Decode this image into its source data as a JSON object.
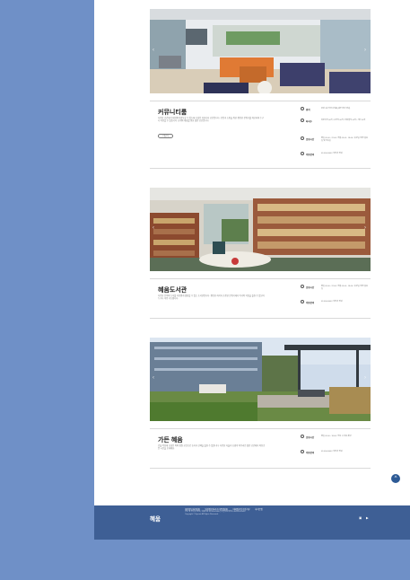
{
  "sections": [
    {
      "title": "커뮤니티룸",
      "desc": "다양한 공간에서 자유롭게 활동할 수 있도록 조성된 커뮤니티 공간입니다. 모임과 소통을 위한 편안한 분위기를 제공하며 누구나 이용할 수 있습니다. 휴게와 대화를 위한 열린 공간입니다.",
      "more": "더보기",
      "details": [
        {
          "icon": "location-icon",
          "label": "위치",
          "value": "본관 1층 커뮤니티룸 (세부 위치 안내)"
        },
        {
          "icon": "seat-icon",
          "label": "좌석수",
          "value": "라운지석 00석 / 소파석 00석 / 테이블석 00석 / 기타 00석"
        },
        {
          "icon": "clock-icon",
          "label": "운영시간",
          "value": "평일 09:00 - 22:00 / 주말 09:00 - 18:00 / 휴관일: 매주 월요일 및 공휴일"
        },
        {
          "icon": "phone-icon",
          "label": "이용문의",
          "value": "02-000-0000 / 담당자 안내"
        }
      ]
    },
    {
      "title": "혜움도서관",
      "desc": "다양한 분야의 도서를 자유롭게 열람할 수 있는 도서관입니다. 편안한 좌석과 조용한 분위기에서 독서와 학습을 즐길 수 있으며 누구나 이용 가능합니다.",
      "more": "",
      "details": [
        {
          "icon": "clock-icon",
          "label": "운영시간",
          "value": "평일 09:00 - 22:00 / 주말 09:00 - 18:00 / 휴관일: 매주 월요일"
        },
        {
          "icon": "phone-icon",
          "label": "이용문의",
          "value": "02-000-0000 / 담당자 안내"
        }
      ]
    },
    {
      "title": "가든 혜움",
      "desc": "건물 옥상에 조성된 야외 정원 공간으로 휴식과 산책을 즐길 수 있습니다. 다양한 식물과 조경이 어우러진 열린 공간에서 여유로운 시간을 보내세요.",
      "more": "",
      "details": [
        {
          "icon": "clock-icon",
          "label": "운영시간",
          "value": "평일 09:00 - 18:00 / 우천 시 이용 제한"
        },
        {
          "icon": "phone-icon",
          "label": "이용문의",
          "value": "02-000-0000 / 담당자 안내"
        }
      ]
    }
  ],
  "footer": {
    "logo": "혜움",
    "links": [
      "개인정보처리방침",
      "영상정보처리기기운영방침",
      "이메일무단수집거부",
      "사이트맵"
    ],
    "address": "주소 및 연락처 정보 | 대표번호 02-000-0000 | 사업자등록번호 000-00-00000",
    "copyright": "Copyright © Hyeum All Rights Reserved."
  },
  "top_button": "^",
  "colors": {
    "side": "#6f90c7",
    "footer": "#3e5f95",
    "accent": "#2d5a95"
  }
}
